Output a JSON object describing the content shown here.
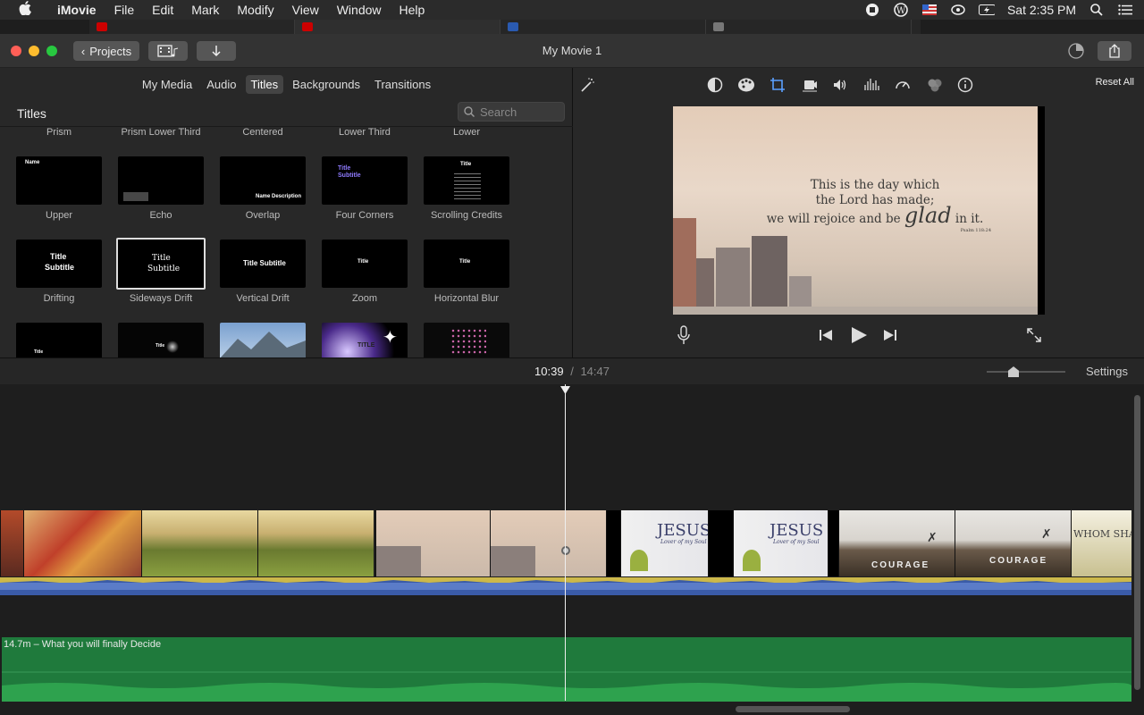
{
  "menubar": {
    "apple": "",
    "app": "iMovie",
    "menus": [
      "File",
      "Edit",
      "Mark",
      "Modify",
      "View",
      "Window",
      "Help"
    ],
    "clock": "Sat 2:35 PM"
  },
  "window": {
    "title": "My Movie 1",
    "projects_label": "Projects"
  },
  "browser": {
    "tabs": [
      "My Media",
      "Audio",
      "Titles",
      "Backgrounds",
      "Transitions"
    ],
    "active_tab": "Titles",
    "section_label": "Titles",
    "search_placeholder": "Search",
    "row0_labels": [
      "Prism",
      "Prism Lower Third",
      "Centered",
      "Lower Third",
      "Lower"
    ],
    "row1_labels": [
      "Upper",
      "Echo",
      "Overlap",
      "Four Corners",
      "Scrolling Credits"
    ],
    "row2_labels": [
      "Drifting",
      "Sideways Drift",
      "Vertical Drift",
      "Zoom",
      "Horizontal Blur"
    ],
    "thumb_text": {
      "upper": "Name",
      "overlap": "Name Description",
      "four_title": "Title",
      "four_sub": "Subtitle",
      "scroll_title": "Title",
      "drift_title": "Title",
      "drift_sub": "Subtitle",
      "sideways_title": "Title",
      "sideways_sub": "Subtitle",
      "vertical": "Title Subtitle",
      "zoom": "Title",
      "hblur": "Title",
      "r3_title": "Title",
      "r3_title2": "Title",
      "r3_title3": "TITLE"
    }
  },
  "viewer": {
    "reset_label": "Reset All",
    "preview_line1": "This is the day which",
    "preview_line2": "the Lord has made;",
    "preview_line3a": "we will rejoice and be ",
    "preview_glad": "glad",
    "preview_line3b": " in it.",
    "preview_ref": "Psalm 118:24"
  },
  "timeline": {
    "current_time": "10:39",
    "separator": "/",
    "total_time": "14:47",
    "settings_label": "Settings",
    "music_label": "14.7m – What you will finally Decide",
    "clip_jesus": "JESUS",
    "clip_jesus_sub": "Lover of my Soul",
    "clip_courage": "COURAGE",
    "clip_whom": "WHOM SHA"
  },
  "colors": {
    "accent_blue": "#3a5ba8",
    "music_green": "#1f7a3c",
    "close": "#ff5f57",
    "minimize": "#febc2e",
    "zoom": "#28c840"
  }
}
